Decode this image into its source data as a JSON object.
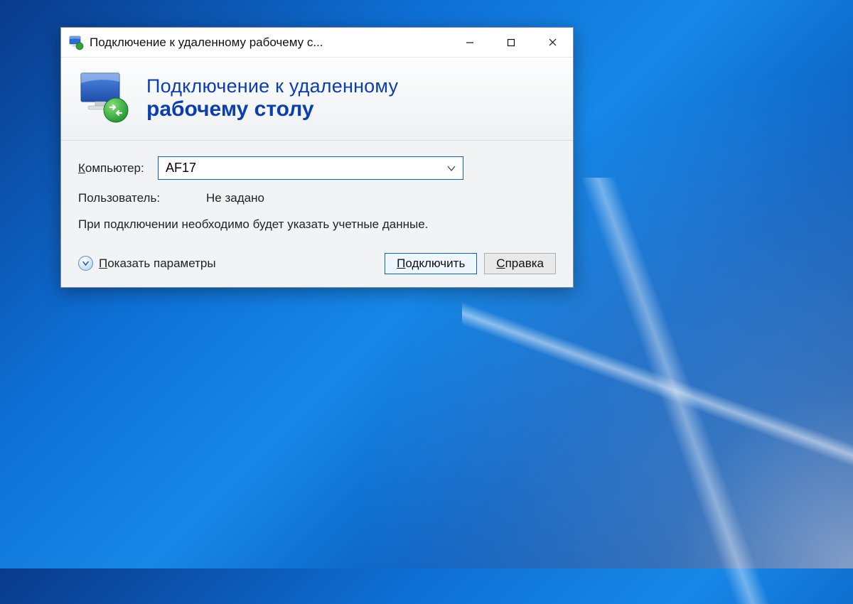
{
  "window": {
    "title": "Подключение к удаленному рабочему с..."
  },
  "banner": {
    "line1": "Подключение к удаленному",
    "line2": "рабочему столу"
  },
  "form": {
    "computer_label_text": "омпьютер:",
    "computer_label_underline": "К",
    "computer_value": "AF17",
    "user_label": "Пользователь:",
    "user_value": "Не задано",
    "info_text": "При подключении необходимо будет указать учетные данные."
  },
  "footer": {
    "expand_underline": "П",
    "expand_text": "оказать параметры",
    "connect_underline": "П",
    "connect_text": "одключить",
    "help_underline": "С",
    "help_text": "правка"
  }
}
